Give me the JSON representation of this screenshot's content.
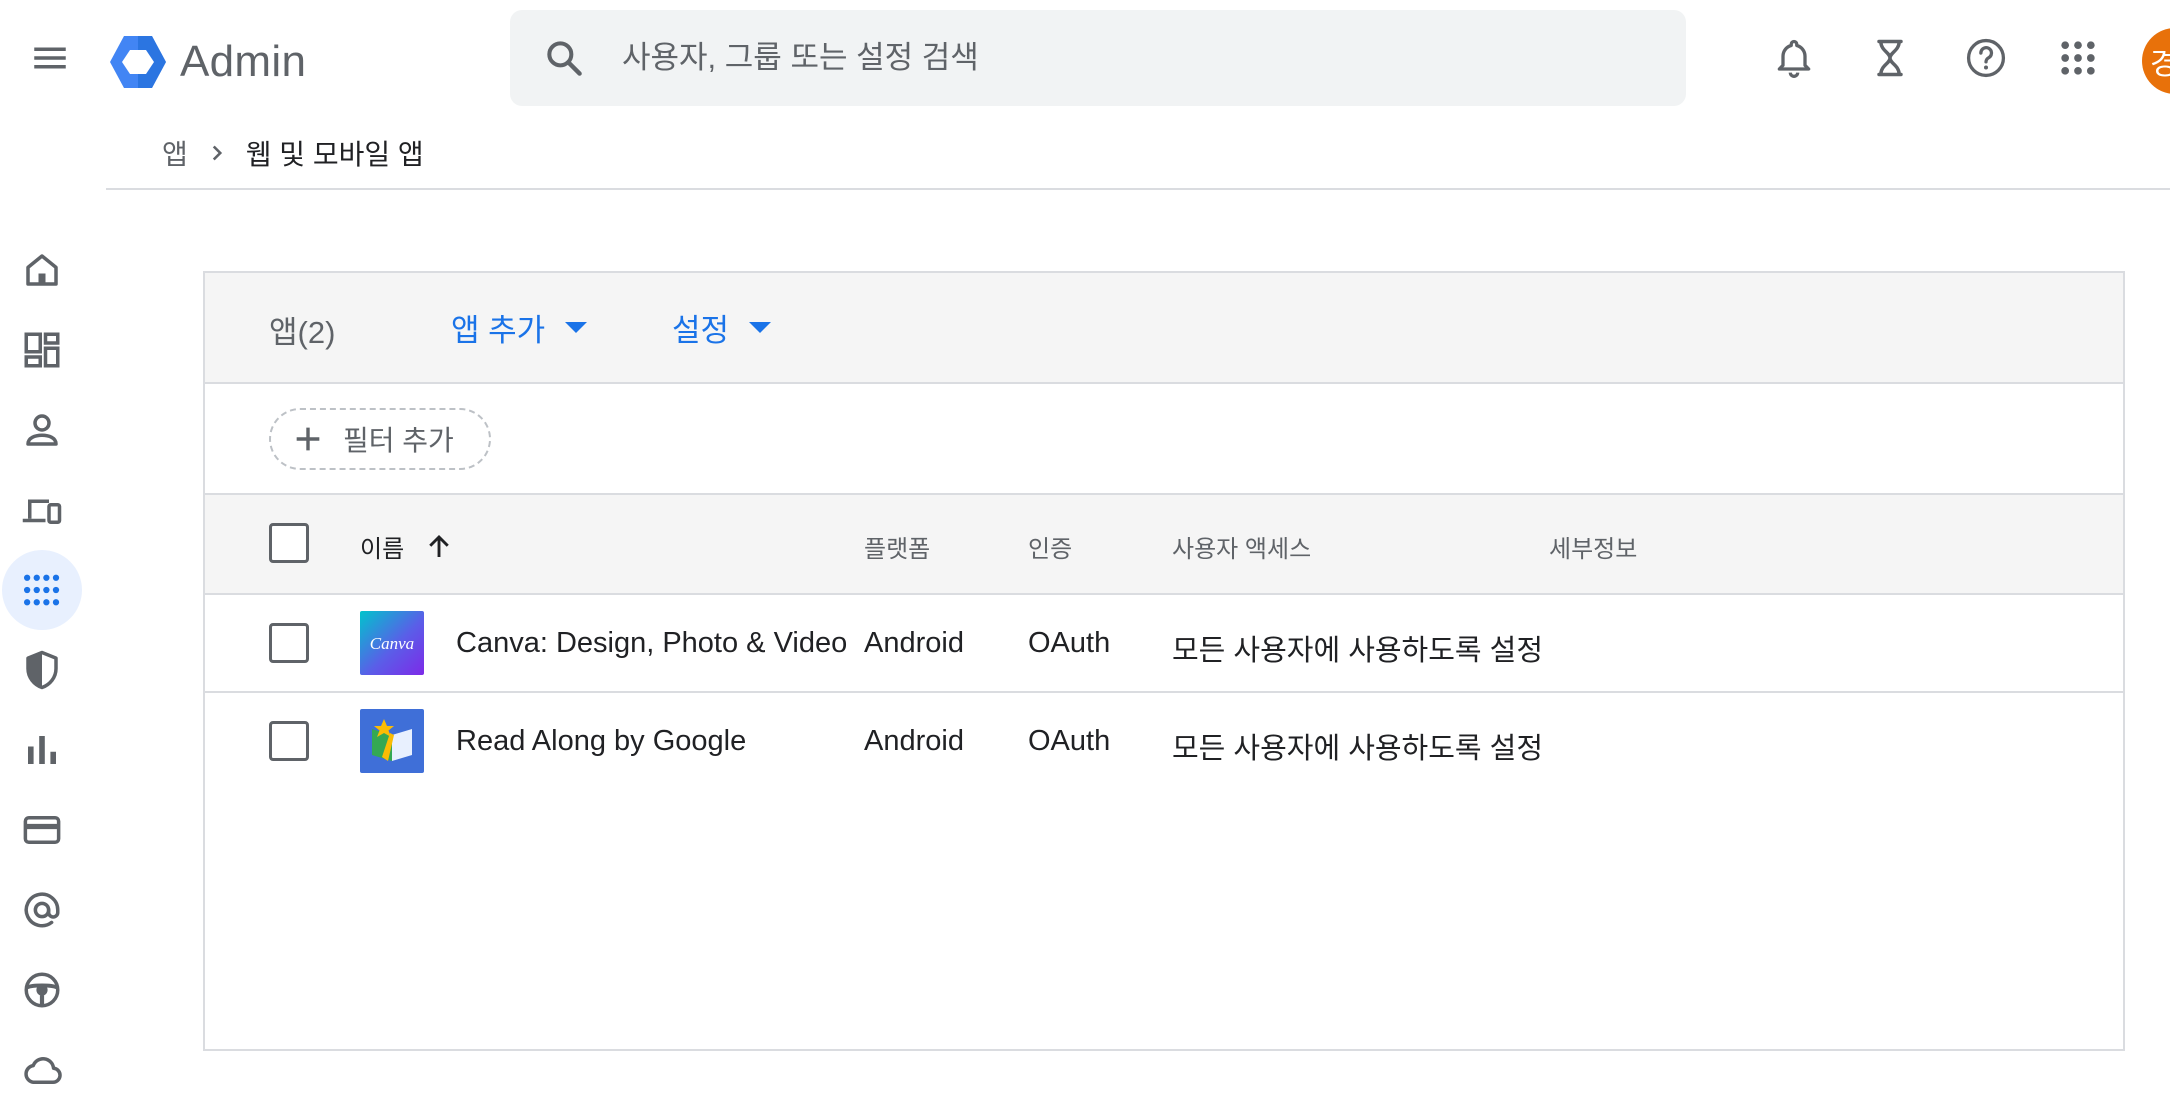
{
  "header": {
    "product_name": "Admin",
    "search_placeholder": "사용자, 그룹 또는 설정 검색",
    "avatar_initial": "경"
  },
  "breadcrumb": {
    "root": "앱",
    "current": "웹 및 모바일 앱"
  },
  "toolbar": {
    "app_count": "앱(2)",
    "add_app_label": "앱 추가",
    "settings_label": "설정"
  },
  "filter": {
    "add_filter_label": "필터 추가"
  },
  "table": {
    "columns": {
      "name": "이름",
      "platform": "플랫폼",
      "auth": "인증",
      "user_access": "사용자 액세스",
      "details": "세부정보"
    },
    "rows": [
      {
        "name": "Canva: Design, Photo & Video",
        "platform": "Android",
        "auth": "OAuth",
        "user_access": "모든 사용자에 사용하도록 설정",
        "icon_text": "Canva"
      },
      {
        "name": "Read Along by Google",
        "platform": "Android",
        "auth": "OAuth",
        "user_access": "모든 사용자에 사용하도록 설정"
      }
    ]
  },
  "colors": {
    "accent": "#1a73e8",
    "icon_gray": "#5f6368",
    "avatar": "#e8710a",
    "header_bg": "#f5f5f5",
    "border": "#dadce0"
  }
}
